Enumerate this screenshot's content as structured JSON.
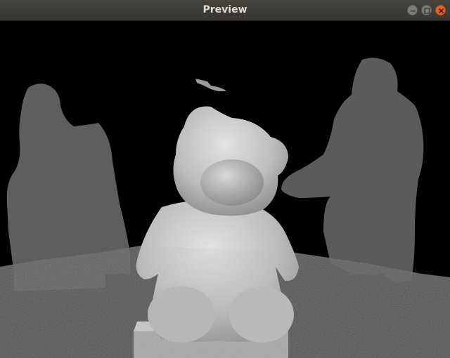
{
  "window": {
    "title": "Preview",
    "controls": [
      {
        "name": "minimize-button",
        "icon": "minimize-icon"
      },
      {
        "name": "maximize-button",
        "icon": "maximize-icon"
      },
      {
        "name": "close-button",
        "icon": "close-icon"
      }
    ]
  },
  "viewport": {
    "content": "depth-point-cloud",
    "colors": {
      "background": "#000000",
      "far_points": "#5c5c5c",
      "bear": "#c8c8c8",
      "floor": "#555555"
    }
  }
}
